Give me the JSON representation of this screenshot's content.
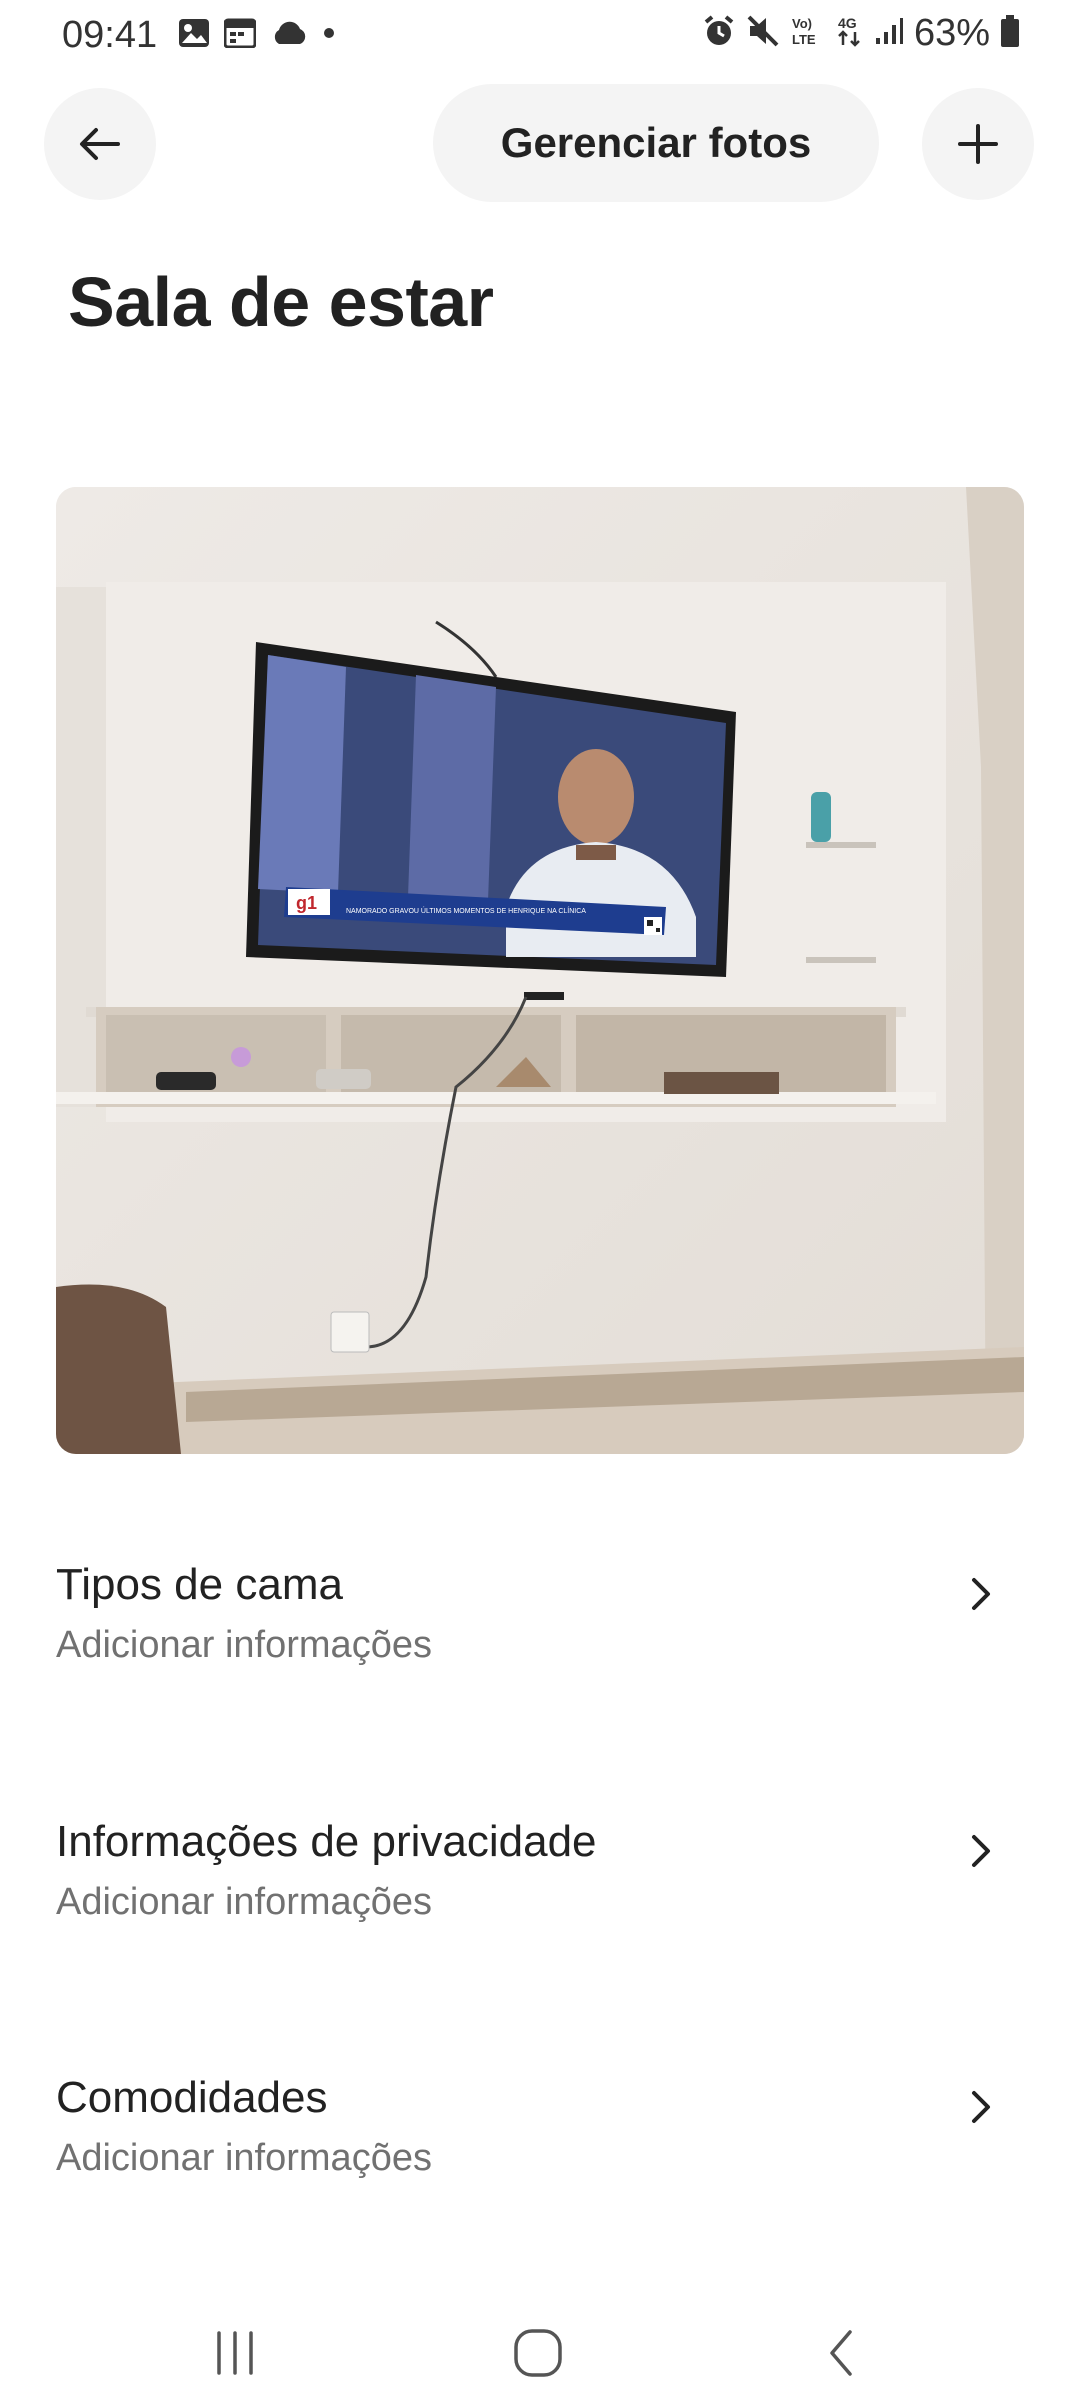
{
  "status_bar": {
    "time": "09:41",
    "left_icons": [
      "image-icon",
      "calendar-icon",
      "cloud-icon",
      "dot-icon"
    ],
    "right_icons": [
      "alarm-icon",
      "mute-icon",
      "volte-icon",
      "4g-icon",
      "signal-icon"
    ],
    "battery_percent": "63%",
    "volte_label": "Vo) LTE",
    "network_label": "4G"
  },
  "header": {
    "manage_photos_label": "Gerenciar fotos"
  },
  "page": {
    "title": "Sala de estar"
  },
  "photo": {
    "tv_channel_logo": "g1",
    "tv_caption": "NAMORADO GRAVOU ÚLTIMOS MOMENTOS DE HENRIQUE NA CLÍNICA"
  },
  "rows": [
    {
      "title": "Tipos de cama",
      "subtitle": "Adicionar informações"
    },
    {
      "title": "Informações de privacidade",
      "subtitle": "Adicionar informações"
    },
    {
      "title": "Comodidades",
      "subtitle": "Adicionar informações"
    }
  ],
  "nav": [
    "recent-apps-icon",
    "home-icon",
    "back-icon"
  ]
}
